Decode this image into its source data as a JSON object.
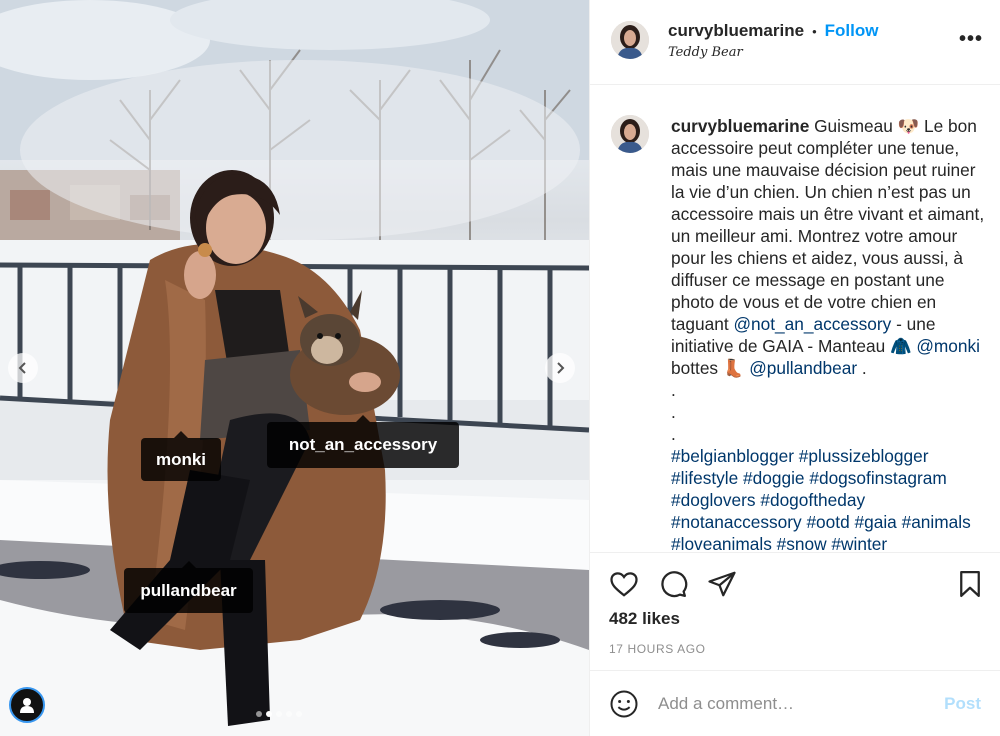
{
  "post": {
    "username": "curvybluemarine",
    "follow_label": "Follow",
    "separator": "•",
    "location": "Teddy Bear",
    "more_label": "•••",
    "caption": {
      "username": "curvybluemarine",
      "text_1": " Guismeau 🐶 Le bon accessoire peut compléter une tenue, mais une mauvaise décision peut ruiner la vie d’un chien. Un chien n’est pas un accessoire mais un être vivant et aimant, un meilleur ami. Montrez votre amour pour les chiens et aidez, vous aussi, à diffuser ce message en postant une photo de vous et de votre chien en taguant ",
      "mention_1": "@not_an_accessory",
      "text_2": " - une initiative de GAIA - Manteau 🧥 ",
      "mention_2": "@monki",
      "text_3": " bottes 👢 ",
      "mention_3": "@pullandbear",
      "text_4": " .",
      "dots": [
        ".",
        ".",
        "."
      ],
      "hashtags": "#belgianblogger #plussizeblogger #lifestyle #doggie #dogsofinstagram #doglovers #dogoftheday #notanaccessory #ootd #gaia #animals #loveanimals #snow #winter"
    },
    "likes": "482 likes",
    "timestamp": "17 HOURS AGO",
    "comment_placeholder": "Add a comment…",
    "post_label": "Post"
  },
  "photo": {
    "tags": [
      {
        "label": "monki"
      },
      {
        "label": "not_an_accessory"
      },
      {
        "label": "pullandbear"
      }
    ],
    "carousel": {
      "count": 5,
      "active_index": 1
    }
  },
  "icons": {
    "like": "heart-icon",
    "comment": "comment-icon",
    "share": "paper-plane-icon",
    "save": "bookmark-icon",
    "emoji": "smiley-icon",
    "prev": "chevron-left-icon",
    "next": "chevron-right-icon",
    "user_tags": "user-icon",
    "more": "more-options-icon"
  },
  "colors": {
    "accent": "#0095f6",
    "text": "#262626",
    "muted": "#8e8e8e",
    "link": "#00376b",
    "post_disabled": "#b2dffc"
  }
}
